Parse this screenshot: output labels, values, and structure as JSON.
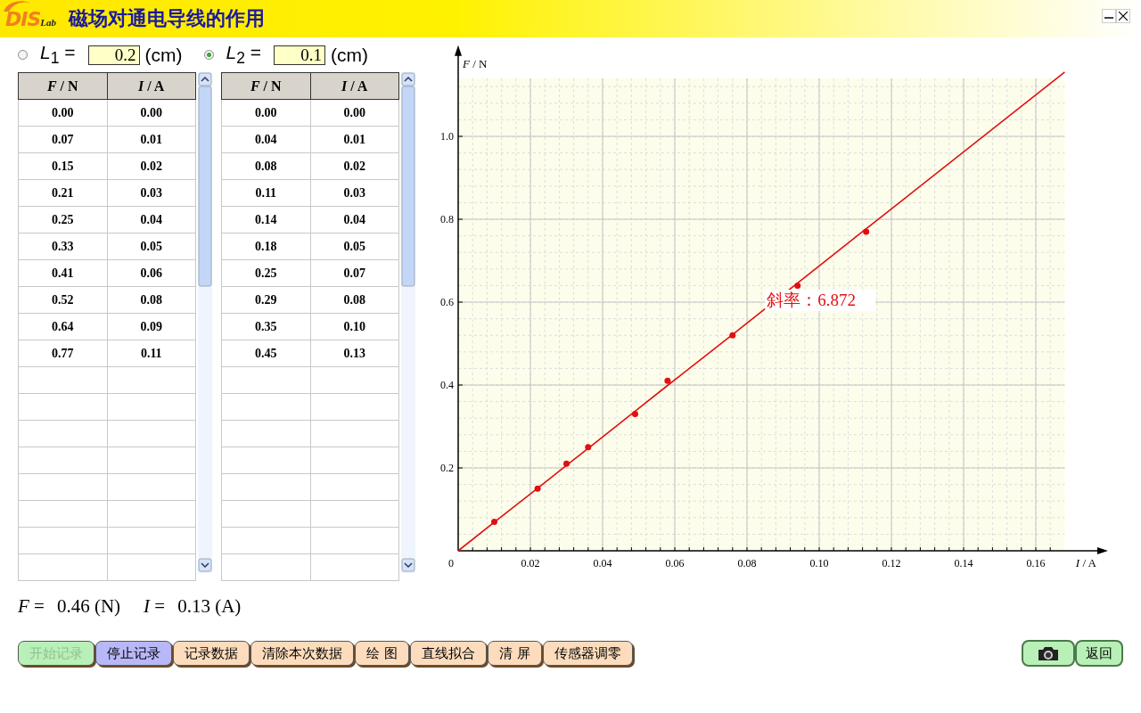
{
  "window": {
    "title": "磁场对通电导线的作用",
    "logo": "DIS",
    "logo_suffix": "Lab"
  },
  "window_controls": [
    {
      "kind": "minimize"
    },
    {
      "kind": "close"
    }
  ],
  "lengths": [
    {
      "label": "*L*$_{1}$ =",
      "value": "0.2",
      "unit": "(cm)",
      "selected": false
    },
    {
      "label": "*L*$_{2}$ =",
      "value": "0.1",
      "unit": "(cm)",
      "selected": true
    }
  ],
  "tables": [
    {
      "columns": [
        "*F* / N",
        "*I* / A"
      ],
      "rows": [
        [
          "0.00",
          "0.00"
        ],
        [
          "0.07",
          "0.01"
        ],
        [
          "0.15",
          "0.02"
        ],
        [
          "0.21",
          "0.03"
        ],
        [
          "0.25",
          "0.04"
        ],
        [
          "0.33",
          "0.05"
        ],
        [
          "0.41",
          "0.06"
        ],
        [
          "0.52",
          "0.08"
        ],
        [
          "0.64",
          "0.09"
        ],
        [
          "0.77",
          "0.11"
        ]
      ]
    },
    {
      "columns": [
        "*F* / N",
        "*I* / A"
      ],
      "rows": [
        [
          "0.00",
          "0.00"
        ],
        [
          "0.04",
          "0.01"
        ],
        [
          "0.08",
          "0.02"
        ],
        [
          "0.11",
          "0.03"
        ],
        [
          "0.14",
          "0.04"
        ],
        [
          "0.18",
          "0.05"
        ],
        [
          "0.25",
          "0.07"
        ],
        [
          "0.29",
          "0.08"
        ],
        [
          "0.35",
          "0.10"
        ],
        [
          "0.45",
          "0.13"
        ]
      ]
    }
  ],
  "readouts": [
    {
      "label": "*F* =",
      "value": "0.46 (N)"
    },
    {
      "label": "*I* =",
      "value": "0.13 (A)"
    }
  ],
  "buttons": [
    {
      "label": "开始记录",
      "color": "#b8f0b8",
      "disabled": true
    },
    {
      "label": "停止记录",
      "color": "#b8b8f8",
      "disabled": false
    },
    {
      "label": "记录数据",
      "color": "#fcdcbc",
      "disabled": false
    },
    {
      "label": "清除本次数据",
      "color": "#fcdcbc",
      "disabled": false
    },
    {
      "label": "绘  图",
      "color": "#fcdcbc",
      "disabled": false
    },
    {
      "label": "直线拟合",
      "color": "#fcdcbc",
      "disabled": false
    },
    {
      "label": "清  屏",
      "color": "#fcdcbc",
      "disabled": false
    },
    {
      "label": "传感器调零",
      "color": "#fcdcbc",
      "disabled": false
    }
  ],
  "right_buttons": [
    {
      "kind": "camera",
      "color": "#b8f0b8"
    },
    {
      "kind": "text",
      "label": "返回",
      "color": "#b8f0b8"
    }
  ],
  "chart": {
    "chart_data": {
      "type": "scatter",
      "xlabel": "*I* / A",
      "ylabel": "*F* / N",
      "x": [
        0,
        0.01,
        0.022,
        0.03,
        0.036,
        0.049,
        0.058,
        0.076,
        0.094,
        0.113,
        0.168
      ],
      "series": [
        {
          "color": "#e01010",
          "values": [
            null,
            0.07,
            0.15,
            0.21,
            0.25,
            0.33,
            0.41,
            0.52,
            0.64,
            0.77,
            null
          ]
        },
        {
          "type": "line",
          "color": "#e01010",
          "values": [
            0,
            0.069,
            0.151,
            0.206,
            0.247,
            0.337,
            0.399,
            0.522,
            0.646,
            0.777,
            1.155
          ]
        }
      ],
      "grid": true,
      "xlim": [
        0,
        0.1785
      ],
      "ylim": [
        0,
        1.207
      ],
      "xticks": [
        {
          "value": 0,
          "label": "0"
        },
        {
          "value": 0.02,
          "label": "0.02"
        },
        {
          "value": 0.04,
          "label": "0.04"
        },
        {
          "value": 0.06,
          "label": "0.06"
        },
        {
          "value": 0.08,
          "label": "0.08"
        },
        {
          "value": 0.1,
          "label": "0.10"
        },
        {
          "value": 0.12,
          "label": "0.12"
        },
        {
          "value": 0.14,
          "label": "0.14"
        },
        {
          "value": 0.16,
          "label": "0.16"
        }
      ],
      "yticks": [
        {
          "value": 0.2,
          "label": "0.2"
        },
        {
          "value": 0.4,
          "label": "0.4"
        },
        {
          "value": 0.6,
          "label": "0.6"
        },
        {
          "value": 0.8,
          "label": "0.8"
        },
        {
          "value": 1.0,
          "label": "1.0"
        }
      ],
      "annotations": [
        "斜率：6.872"
      ]
    }
  }
}
